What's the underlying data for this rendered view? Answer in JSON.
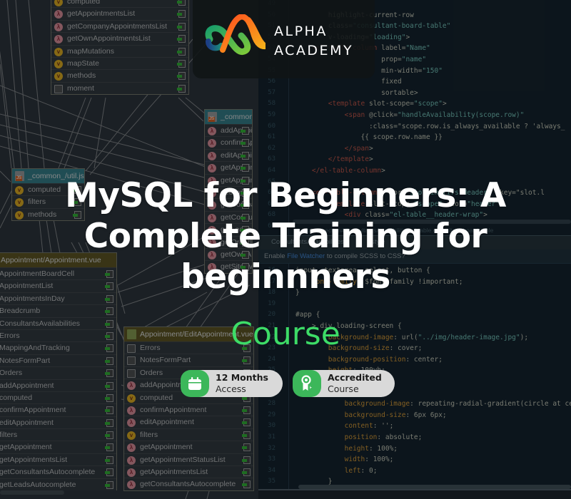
{
  "brand": {
    "name_line1": "ALPHA",
    "name_line2": "ACADEMY",
    "colors": {
      "orange": "#f07a1a",
      "green": "#36b34a",
      "blue": "#1f4f8a"
    }
  },
  "headline": {
    "title": "MySQL for Beginners: A Complete Training for beginnners",
    "subtitle": "Course",
    "title_color": "#ffffff",
    "subtitle_color": "#3ddc67"
  },
  "badges": [
    {
      "icon": "calendar-icon",
      "line1": "12 Months",
      "line2": "Access"
    },
    {
      "icon": "award-ribbon-icon",
      "line1": "Accredited",
      "line2": "Course"
    }
  ],
  "background": {
    "diagram": {
      "top_box": {
        "rows": [
          {
            "icon": "v",
            "label": "computed"
          },
          {
            "icon": "l",
            "label": "getAppointmentsList"
          },
          {
            "icon": "l",
            "label": "getCompanyAppointmentsList"
          },
          {
            "icon": "l",
            "label": "getOwnAppointmentsList"
          },
          {
            "icon": "v",
            "label": "mapMutations"
          },
          {
            "icon": "v",
            "label": "mapState"
          },
          {
            "icon": "v",
            "label": "methods"
          },
          {
            "icon": "imp",
            "label": "moment"
          }
        ]
      },
      "util_box": {
        "header": "_common_/util.js",
        "rows": [
          {
            "icon": "v",
            "label": "computed"
          },
          {
            "icon": "v",
            "label": "filters"
          },
          {
            "icon": "v",
            "label": "methods"
          }
        ]
      },
      "common_box": {
        "header": "_common_",
        "rows": [
          {
            "icon": "l",
            "label": "addAppointment"
          },
          {
            "icon": "l",
            "label": "confirmAppointment"
          },
          {
            "icon": "l",
            "label": "editAppointment"
          },
          {
            "icon": "l",
            "label": "getAppointment"
          },
          {
            "icon": "l",
            "label": "getAppointmentsList"
          },
          {
            "icon": "l",
            "label": "getAppointmentStatusList"
          },
          {
            "icon": "l",
            "label": "getCompanyAppointmentsList"
          },
          {
            "icon": "l",
            "label": "getConsultantsAutocomplete"
          },
          {
            "icon": "l",
            "label": "getLeadsAutocomplete"
          },
          {
            "icon": "l",
            "label": "getOrderList"
          },
          {
            "icon": "l",
            "label": "getOwnAppointmentsList"
          },
          {
            "icon": "l",
            "label": "getSiteEvents"
          }
        ]
      },
      "appointment_box": {
        "header": "Appointment/Appointment.vue",
        "rows": [
          "AppointmentBoardCell",
          "AppointmentList",
          "AppointmentsInDay",
          "Breadcrumb",
          "ConsultantsAvailabilities",
          "Errors",
          "MappingAndTracking",
          "NotesFormPart",
          "Orders",
          "addAppointment",
          "computed",
          "confirmAppointment",
          "editAppointment",
          "filters",
          "getAppointment",
          "getAppointmentsList",
          "getConsultantsAutocomplete",
          "getLeadsAutocomplete"
        ]
      },
      "edit_box": {
        "header": "Appointment/EditAppointment.vue",
        "rows": [
          {
            "icon": "imp",
            "label": "Errors"
          },
          {
            "icon": "imp",
            "label": "NotesFormPart"
          },
          {
            "icon": "imp",
            "label": "Orders"
          },
          {
            "icon": "l",
            "label": "addAppointment"
          },
          {
            "icon": "v",
            "label": "computed"
          },
          {
            "icon": "l",
            "label": "confirmAppointment"
          },
          {
            "icon": "l",
            "label": "editAppointment"
          },
          {
            "icon": "v",
            "label": "filters"
          },
          {
            "icon": "l",
            "label": "getAppointment"
          },
          {
            "icon": "l",
            "label": "getAppointmentStatusList"
          },
          {
            "icon": "l",
            "label": "getAppointmentsList"
          },
          {
            "icon": "l",
            "label": "getConsultantsAutocomplete"
          }
        ]
      }
    },
    "editor": {
      "top_line_numbers": [
        "49",
        "50",
        "51",
        "52",
        "53",
        "54",
        "55",
        "56",
        "57",
        "58",
        "59",
        "60",
        "61",
        "62",
        "63",
        "64",
        "65",
        "66",
        "67",
        "68",
        "69"
      ],
      "top_code": [
        "",
        "        highlight-current-row",
        "        class=\"consultant-board-table\"",
        "        v-loading=\"loading\">",
        "    <el-table-column label=\"Name\"",
        "                     prop=\"name\"",
        "                     min-width=\"150\"",
        "                     fixed",
        "                     sortable>",
        "        <template slot-scope=\"scope\">",
        "            <span @click=\"handleAvailability(scope.row)\"",
        "                  :class=\"scope.row.is_always_available ? 'always_",
        "                {{ scope.row.name }}",
        "            </span>",
        "        </template>",
        "    </el-table-column>",
        "",
        "    <el-table-column v-for=\"slot in firstHeader\" :key=\"slot.l",
        "        <template slot-scope=\"scope\" slot=\"header\">",
        "            <div class=\"el-table__header-wrap\">",
        ""
      ],
      "breadcrumb": "template  section#ConsultantsAvailabilities  el-table.consultant-board-table",
      "tabs": [
        "ConsultantsAvailabilities",
        "style"
      ],
      "notice": {
        "prefix": "Enable ",
        "link": "File Watcher",
        "suffix": " to compile SCSS to CSS?"
      },
      "bottom_line_numbers": [
        "16",
        "17",
        "18",
        "19",
        "20",
        "21",
        "22",
        "23",
        "24",
        "25",
        "26",
        "27",
        "28",
        "29",
        "30",
        "31",
        "32",
        "33",
        "34",
        "35"
      ],
      "bottom_code": [
        "input, textarea, select, button {",
        "    font-family: $font-family !important;",
        "}",
        "",
        "#app {",
        "    > div.loading-screen {",
        "        background-image: url(\"../img/header-image.jpg\");",
        "        background-size: cover;",
        "        background-position: center;",
        "        height: 100vh;",
        "",
        "        &:before {",
        "            background-image: repeating-radial-gradient(circle at center, rgba(0",
        "            background-size: 6px 6px;",
        "            content: '';",
        "            position: absolute;",
        "            height: 100%;",
        "            width: 100%;",
        "            left: 0;",
        "        }"
      ]
    }
  }
}
